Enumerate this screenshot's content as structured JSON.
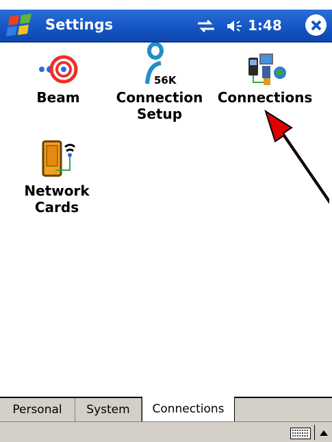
{
  "titlebar": {
    "title": "Settings",
    "time": "1:48"
  },
  "items": [
    {
      "label": "Beam",
      "icon": "beam-icon"
    },
    {
      "label": "Connection\nSetup",
      "icon": "connection-setup-icon",
      "badge": "56K"
    },
    {
      "label": "Connections",
      "icon": "connections-icon"
    },
    {
      "label": "Network\nCards",
      "icon": "network-cards-icon"
    }
  ],
  "tabs": [
    {
      "label": "Personal",
      "active": false
    },
    {
      "label": "System",
      "active": false
    },
    {
      "label": "Connections",
      "active": true
    }
  ],
  "colors": {
    "titlebar": "#1556c4",
    "annotation_arrow": "#e00000"
  }
}
